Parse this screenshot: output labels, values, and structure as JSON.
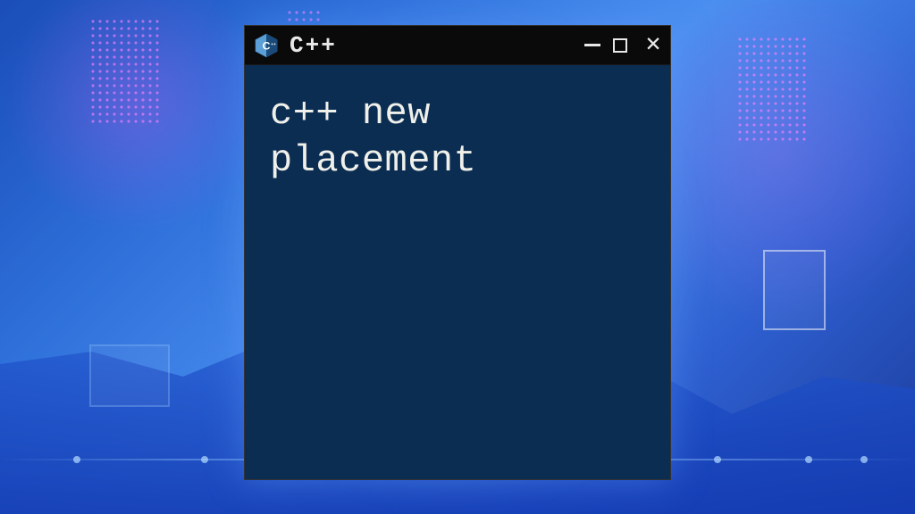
{
  "window": {
    "title": "C++",
    "icon_label": "C++"
  },
  "terminal": {
    "content": "c++ new\nplacement"
  },
  "colors": {
    "terminal_bg": "#0b2d52",
    "titlebar_bg": "#0a0a0a",
    "text": "#f0f0eb"
  }
}
